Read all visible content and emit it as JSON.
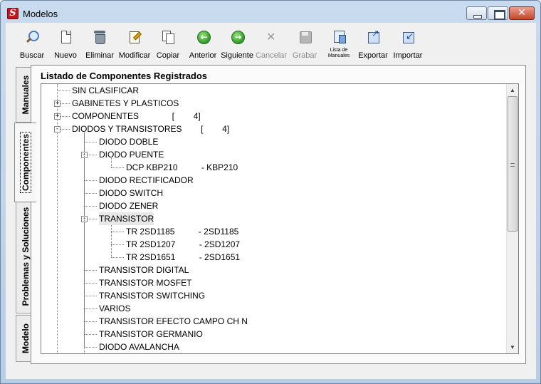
{
  "window": {
    "title": "Modelos",
    "icon_letter": "S",
    "minimize_label": "–",
    "maximize_label": "□",
    "close_label": "✕"
  },
  "toolbar": {
    "buttons": [
      {
        "id": "buscar",
        "label": "Buscar",
        "icon": "search-icon",
        "enabled": true
      },
      {
        "id": "nuevo",
        "label": "Nuevo",
        "icon": "new-document-icon",
        "enabled": true
      },
      {
        "id": "eliminar",
        "label": "Eliminar",
        "icon": "trash-icon",
        "enabled": true
      },
      {
        "id": "modificar",
        "label": "Modificar",
        "icon": "edit-icon",
        "enabled": true
      },
      {
        "id": "copiar",
        "label": "Copiar",
        "icon": "copy-icon",
        "enabled": true
      },
      {
        "id": "anterior",
        "label": "Anterior",
        "icon": "back-arrow-icon",
        "enabled": true
      },
      {
        "id": "siguiente",
        "label": "Siguiente",
        "icon": "forward-arrow-icon",
        "enabled": true
      },
      {
        "id": "cancelar",
        "label": "Cancelar",
        "icon": "cancel-icon",
        "enabled": false
      },
      {
        "id": "grabar",
        "label": "Grabar",
        "icon": "save-icon",
        "enabled": false
      },
      {
        "id": "lista",
        "label": "Lista de Manuales",
        "icon": "manual-list-icon",
        "enabled": true
      },
      {
        "id": "exportar",
        "label": "Exportar",
        "icon": "export-icon",
        "enabled": true
      },
      {
        "id": "importar",
        "label": "Importar",
        "icon": "import-icon",
        "enabled": true
      }
    ]
  },
  "tabs": [
    {
      "label": "Manuales",
      "active": false
    },
    {
      "label": "Componentes",
      "active": true
    },
    {
      "label": "Problemas y Soluciones",
      "active": false
    },
    {
      "label": "Modelo",
      "active": false
    }
  ],
  "panel": {
    "title": "Listado de Componentes Registrados"
  },
  "tree": [
    {
      "text": "SIN CLASIFICAR",
      "level": 0,
      "expander": null
    },
    {
      "text": "GABINETES Y PLASTICOS",
      "level": 0,
      "expander": "+"
    },
    {
      "text": "COMPONENTES              [        4]",
      "level": 0,
      "expander": "+"
    },
    {
      "text": "DIODOS Y TRANSISTORES        [        4]",
      "level": 0,
      "expander": "-"
    },
    {
      "text": "DIODO DOBLE",
      "level": 1,
      "expander": null
    },
    {
      "text": "DIODO PUENTE",
      "level": 1,
      "expander": "-"
    },
    {
      "text": "DCP KBP210          - KBP210",
      "level": 2,
      "expander": null
    },
    {
      "text": "DIODO RECTIFICADOR",
      "level": 1,
      "expander": null
    },
    {
      "text": "DIODO SWITCH",
      "level": 1,
      "expander": null
    },
    {
      "text": "DIODO ZENER",
      "level": 1,
      "expander": null
    },
    {
      "text": "TRANSISTOR",
      "level": 1,
      "expander": "-",
      "selected": true
    },
    {
      "text": "TR 2SD1185          - 2SD1185",
      "level": 2,
      "expander": null
    },
    {
      "text": "TR 2SD1207          - 2SD1207",
      "level": 2,
      "expander": null
    },
    {
      "text": "TR 2SD1651          - 2SD1651",
      "level": 2,
      "expander": null
    },
    {
      "text": "TRANSISTOR DIGITAL",
      "level": 1,
      "expander": null
    },
    {
      "text": "TRANSISTOR MOSFET",
      "level": 1,
      "expander": null
    },
    {
      "text": "TRANSISTOR SWITCHING",
      "level": 1,
      "expander": null
    },
    {
      "text": "VARIOS",
      "level": 1,
      "expander": null
    },
    {
      "text": "TRANSISTOR EFECTO CAMPO CH N",
      "level": 1,
      "expander": null
    },
    {
      "text": "TRANSISTOR GERMANIO",
      "level": 1,
      "expander": null
    },
    {
      "text": "DIODO AVALANCHA",
      "level": 1,
      "expander": null
    }
  ],
  "scrollbar": {
    "up_arrow": "▲",
    "down_arrow": "▼",
    "position": 0.0
  },
  "colors": {
    "frame": "#b7cde6",
    "selection": "#e8e8e8",
    "disabled_text": "#8a8a8a"
  }
}
